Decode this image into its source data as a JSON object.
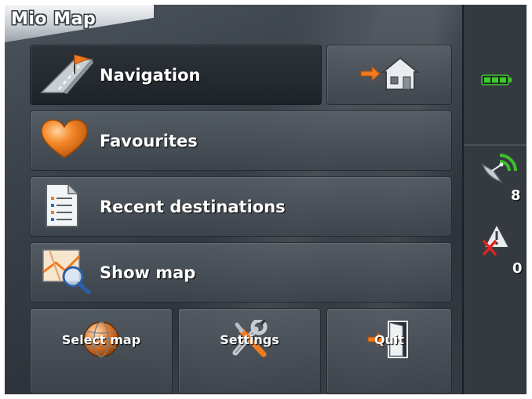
{
  "app": {
    "title": "Mio Map"
  },
  "menu": {
    "navigation_label": "Navigation",
    "favourites_label": "Favourites",
    "recent_label": "Recent destinations",
    "show_map_label": "Show map"
  },
  "bottom": {
    "select_map_label": "Select map",
    "settings_label": "Settings",
    "quit_label": "Quit"
  },
  "status": {
    "satellites_count": "8",
    "alerts_count": "0"
  },
  "icons": {
    "navigation": "navigation-flag-icon",
    "home": "go-home-icon",
    "favourites": "heart-icon",
    "recent": "list-icon",
    "show_map": "map-magnifier-icon",
    "select_map": "globe-icon",
    "settings": "tools-icon",
    "quit": "exit-door-icon",
    "battery": "battery-icon",
    "satellite": "satellite-icon",
    "alert": "warning-icon"
  },
  "colors": {
    "accent_orange": "#f07a1e",
    "battery_green": "#3ccb2a",
    "signal_green": "#3fbf2a"
  }
}
